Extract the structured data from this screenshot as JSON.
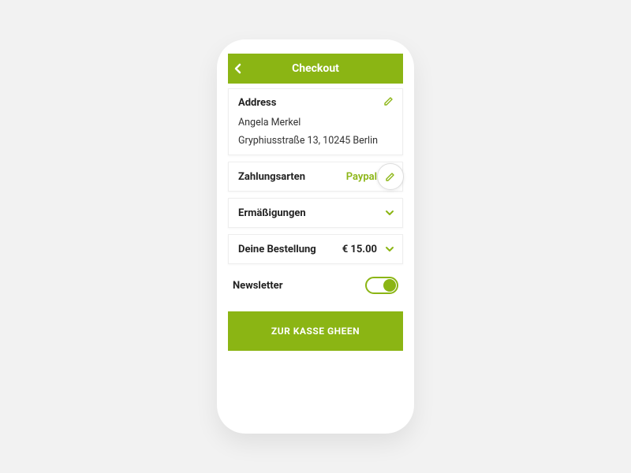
{
  "header": {
    "title": "Checkout"
  },
  "address": {
    "label": "Address",
    "name": "Angela Merkel",
    "street": "Gryphiusstraße 13, 10245 Berlin"
  },
  "payment": {
    "label": "Zahlungsarten",
    "value": "Paypal"
  },
  "discounts": {
    "label": "Ermäßigungen"
  },
  "order": {
    "label": "Deine Bestellung",
    "price": "€ 15.00"
  },
  "newsletter": {
    "label": "Newsletter",
    "on": true
  },
  "cta": {
    "label": "ZUR KASSE GHEEN"
  },
  "colors": {
    "accent": "#8bb514"
  }
}
